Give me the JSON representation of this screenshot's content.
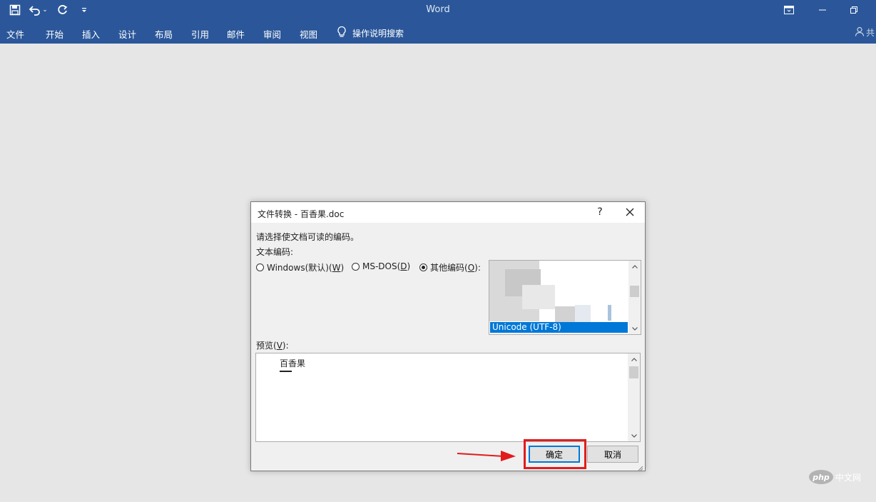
{
  "app": {
    "title": "Word"
  },
  "ribbon": {
    "tabs": [
      "文件",
      "开始",
      "插入",
      "设计",
      "布局",
      "引用",
      "邮件",
      "审阅",
      "视图"
    ],
    "tell_me": "操作说明搜索",
    "share_partial": "共"
  },
  "dialog": {
    "title": "文件转换 - 百香果.doc",
    "help": "?",
    "instruction": "请选择使文档可读的编码。",
    "encoding_label": "文本编码:",
    "radios": [
      {
        "label": "Windows(默认)(",
        "key": "W",
        "suffix": ")",
        "checked": false
      },
      {
        "label": "MS-DOS(",
        "key": "D",
        "suffix": ")",
        "checked": false
      },
      {
        "label": "其他编码(",
        "key": "O",
        "suffix": "):",
        "checked": true
      }
    ],
    "encoding_selected": "Unicode (UTF-8)",
    "preview_label_pre": "预览(",
    "preview_label_key": "V",
    "preview_label_post": "):",
    "preview_text": "百香果",
    "ok_label": "确定",
    "cancel_label": "取消"
  },
  "watermark": {
    "logo": "php",
    "text": "中文网"
  }
}
